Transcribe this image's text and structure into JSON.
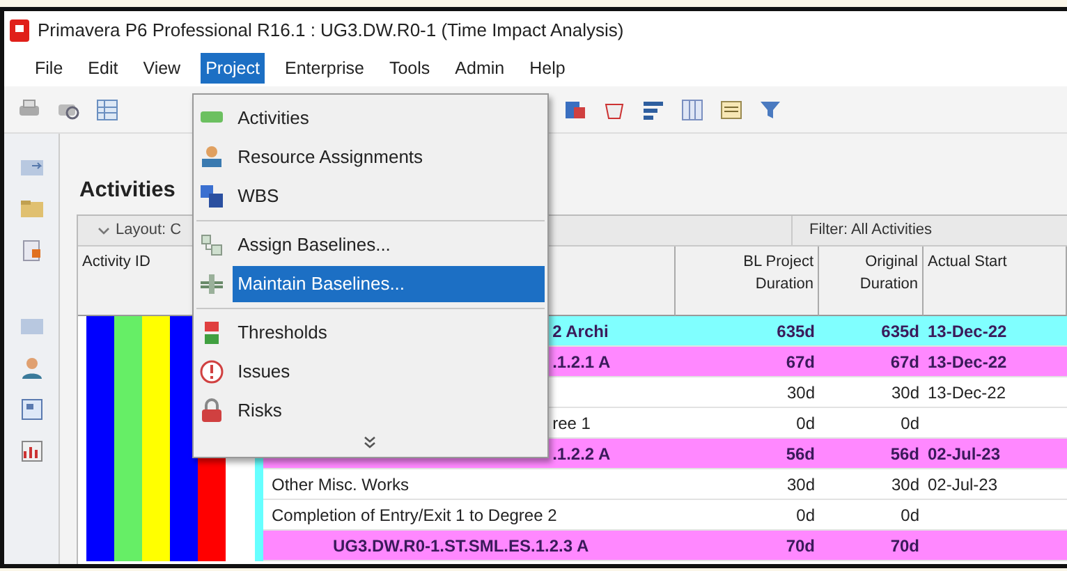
{
  "window": {
    "title": "Primavera P6 Professional R16.1 : UG3.DW.R0-1 (Time Impact Analysis)"
  },
  "menu_bar": [
    {
      "label": "File",
      "selected": false
    },
    {
      "label": "Edit",
      "selected": false
    },
    {
      "label": "View",
      "selected": false
    },
    {
      "label": "Project",
      "selected": true
    },
    {
      "label": "Enterprise",
      "selected": false
    },
    {
      "label": "Tools",
      "selected": false
    },
    {
      "label": "Admin",
      "selected": false
    },
    {
      "label": "Help",
      "selected": false
    }
  ],
  "project_menu": [
    {
      "kind": "item",
      "label": "Activities",
      "selected": false
    },
    {
      "kind": "item",
      "label": "Resource Assignments",
      "selected": false
    },
    {
      "kind": "item",
      "label": "WBS",
      "selected": false
    },
    {
      "kind": "separator"
    },
    {
      "kind": "item",
      "label": "Assign Baselines...",
      "selected": false
    },
    {
      "kind": "item",
      "label": "Maintain Baselines...",
      "selected": true
    },
    {
      "kind": "separator"
    },
    {
      "kind": "item",
      "label": "Thresholds",
      "selected": false
    },
    {
      "kind": "item",
      "label": "Issues",
      "selected": false
    },
    {
      "kind": "item",
      "label": "Risks",
      "selected": false
    },
    {
      "kind": "more"
    }
  ],
  "panel": {
    "title": "Activities",
    "layout": "Layout: C",
    "filter": "Filter: All Activities"
  },
  "wbs_strips": [
    {
      "color": "#0000ff"
    },
    {
      "color": "#66ee66"
    },
    {
      "color": "#ffff00"
    },
    {
      "color": "#0000ff"
    },
    {
      "color": "#ff0000"
    },
    {
      "color": "#66ffff"
    }
  ],
  "table": {
    "columns": [
      "Activity ID",
      "BL Project Duration",
      "Original Duration",
      "Actual Start"
    ],
    "rows": [
      {
        "kind": "band",
        "color": "#80ffff",
        "name": "2 Archi",
        "bl_duration": "635d",
        "original_duration": "635d",
        "actual_start": "13-Dec-22"
      },
      {
        "kind": "band",
        "color": "#ff88ff",
        "name": ".1.2.1 A",
        "bl_duration": "67d",
        "original_duration": "67d",
        "actual_start": "13-Dec-22"
      },
      {
        "kind": "activity",
        "color": "#ffffff",
        "name": "",
        "bl_duration": "30d",
        "original_duration": "30d",
        "actual_start": "13-Dec-22"
      },
      {
        "kind": "activity",
        "color": "#ffffff",
        "name": "ree 1",
        "bl_duration": "0d",
        "original_duration": "0d",
        "actual_start": ""
      },
      {
        "kind": "band",
        "color": "#ff88ff",
        "name": ".1.2.2 A",
        "bl_duration": "56d",
        "original_duration": "56d",
        "actual_start": "02-Jul-23"
      },
      {
        "kind": "activity",
        "color": "#ffffff",
        "name": "Other Misc. Works",
        "bl_duration": "30d",
        "original_duration": "30d",
        "actual_start": "02-Jul-23"
      },
      {
        "kind": "activity",
        "color": "#ffffff",
        "name": "Completion of Entry/Exit 1 to Degree 2",
        "bl_duration": "0d",
        "original_duration": "0d",
        "actual_start": ""
      },
      {
        "kind": "band",
        "color": "#ff88ff",
        "name": "UG3.DW.R0-1.ST.SML.ES.1.2.3 A",
        "bl_duration": "70d",
        "original_duration": "70d",
        "actual_start": ""
      }
    ]
  }
}
